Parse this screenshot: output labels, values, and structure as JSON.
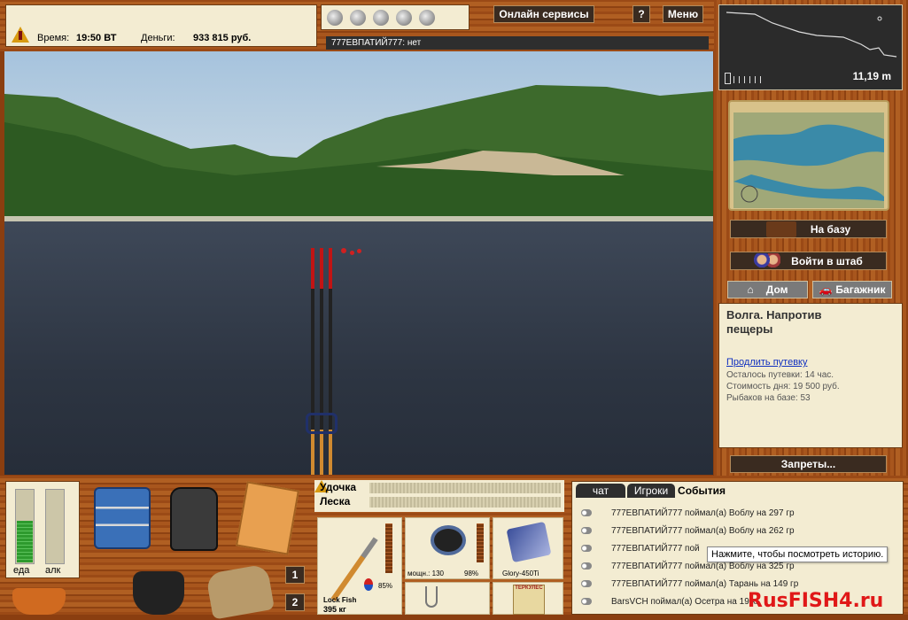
{
  "status": {
    "time_label": "Время:",
    "time_value": "19:50 ВТ",
    "money_label": "Деньги:",
    "money_value": "933 815 руб."
  },
  "top": {
    "online_services": "Онлайн сервисы",
    "help": "?",
    "menu": "Меню"
  },
  "player_line": "777ЕВПАТИЙ777: нет",
  "depth": {
    "value": "11,19 m"
  },
  "location": {
    "title": "Волга. Напротив пещеры",
    "extend_link": "Продлить путевку",
    "remaining": "Осталось путевки: 14 час.",
    "cost": "Стоимость дня: 19 500 руб.",
    "fishers": "Рыбаков на базе: 53"
  },
  "buttons": {
    "to_base": "На базу",
    "hq": "Войти в штаб",
    "home": "Дом",
    "trunk": "Багажник",
    "bans": "Запреты..."
  },
  "meters": {
    "food": "еда",
    "alcohol": "алк",
    "food_level": 0.55,
    "alcohol_level": 0.0
  },
  "gear_status": {
    "rod_label": "Удочка",
    "line_label": "Леска"
  },
  "inventory_slots": [
    "1",
    "2"
  ],
  "items": [
    {
      "name": "Lock Fish",
      "weight": "395 кг",
      "pct": "85%"
    },
    {
      "power": "мощн.: 130",
      "pct": "98%"
    },
    {
      "name": "Glory-450Ti"
    },
    {
      "name": "ТЕРКУЛЕС"
    }
  ],
  "chat": {
    "tabs": [
      "чат",
      "Игроки",
      "События"
    ],
    "tooltip": "Нажмите, чтобы посмотреть историю.",
    "messages": [
      "777ЕВПАТИЙ777 поймал(а) Воблу на 297 гр",
      "777ЕВПАТИЙ777 поймал(а) Воблу на 262 гр",
      "777ЕВПАТИЙ777 пой",
      "777ЕВПАТИЙ777 поймал(а) Воблу на 325 гр",
      "777ЕВПАТИЙ777 поймал(а) Тарань на 149 гр",
      "BarsVCH поймал(а) Осетра на 19 кг"
    ]
  },
  "watermark": "RusFISH4.ru"
}
